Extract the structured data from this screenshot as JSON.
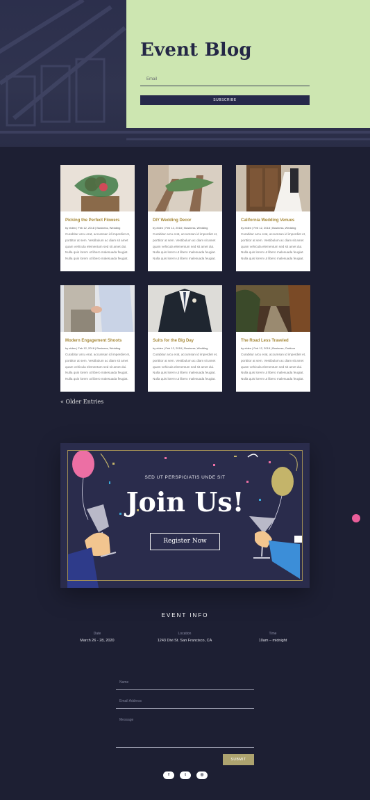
{
  "hero": {
    "title": "Event Blog",
    "email_placeholder": "Email",
    "subscribe_label": "SUBSCRIBE"
  },
  "posts": [
    {
      "title": "Picking the Perfect Flowers",
      "meta": "by elden | Feb 12, 2018 | Business, Wedding",
      "excerpt": "Curabitur arcu erat, accumsan id imperdiet et, porttitor at sem. Vestibulum ac diam sit amet quam vehicula elementum sed sit amet dui. Nulla quis lorem ut libero malesuada feugiat. Nulla quis lorem ut libero malesuada feugiat."
    },
    {
      "title": "DIY Wedding Decor",
      "meta": "by elden | Feb 12, 2018 | Business, Wedding",
      "excerpt": "Curabitur arcu erat, accumsan id imperdiet et, porttitor at sem. Vestibulum ac diam sit amet quam vehicula elementum sed sit amet dui. Nulla quis lorem ut libero malesuada feugiat. Nulla quis lorem ut libero malesuada feugiat."
    },
    {
      "title": "California Wedding Venues",
      "meta": "by elden | Feb 12, 2018 | Business, Wedding",
      "excerpt": "Curabitur arcu erat, accumsan id imperdiet et, porttitor at sem. Vestibulum ac diam sit amet quam vehicula elementum sed sit amet dui. Nulla quis lorem ut libero malesuada feugiat. Nulla quis lorem ut libero malesuada feugiat."
    },
    {
      "title": "Modern Engagement Shoots",
      "meta": "by elden | Feb 12, 2018 | Business, Wedding",
      "excerpt": "Curabitur arcu erat, accumsan id imperdiet et, porttitor at sem. Vestibulum ac diam sit amet quam vehicula elementum sed sit amet dui. Nulla quis lorem ut libero malesuada feugiat. Nulla quis lorem ut libero malesuada feugiat."
    },
    {
      "title": "Suits for the Big Day",
      "meta": "by elden | Feb 12, 2018 | Business, Wedding",
      "excerpt": "Curabitur arcu erat, accumsan id imperdiet et, porttitor at sem. Vestibulum ac diam sit amet quam vehicula elementum sed sit amet dui. Nulla quis lorem ut libero malesuada feugiat. Nulla quis lorem ut libero malesuada feugiat."
    },
    {
      "title": "The Road Less Traveled",
      "meta": "by elden | Feb 12, 2018 | Business, Outdoor",
      "excerpt": "Curabitur arcu erat, accumsan id imperdiet et, porttitor at sem. Vestibulum ac diam sit amet quam vehicula elementum sed sit amet dui. Nulla quis lorem ut libero malesuada feugiat. Nulla quis lorem ut libero malesuada feugiat."
    }
  ],
  "older_entries": "« Older Entries",
  "join": {
    "subtitle": "SED UT PERSPICIATIS UNDE SIT",
    "title": "Join Us!",
    "button": "Register Now"
  },
  "event_info": {
    "heading": "EVENT INFO",
    "date_label": "Date",
    "date_value": "March 26 - 28, 2020",
    "location_label": "Location",
    "location_value": "1243 Divi St. San Francisco, CA",
    "time_label": "Time",
    "time_value": "10am – midnight"
  },
  "form": {
    "name": "Name",
    "email": "Email Address",
    "message": "Message",
    "submit": "SUBMIT"
  },
  "social": [
    {
      "icon": "facebook-icon",
      "glyph": "f"
    },
    {
      "icon": "twitter-icon",
      "glyph": "t"
    },
    {
      "icon": "instagram-icon",
      "glyph": "◎"
    }
  ],
  "colors": {
    "background": "#1d1f33",
    "subscribe_card": "#cde6b1",
    "accent_gold": "#a78a3b",
    "pink": "#ea5e9a"
  }
}
